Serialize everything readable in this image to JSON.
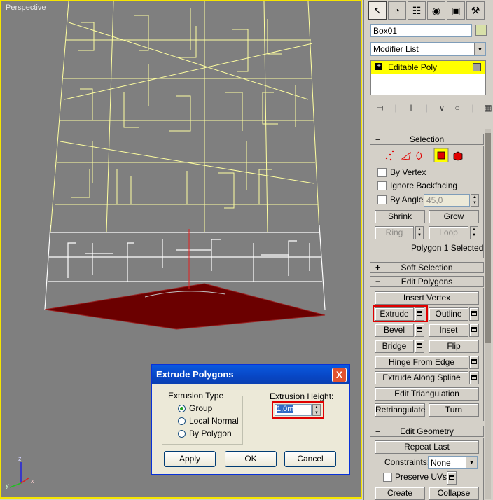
{
  "viewport": {
    "label": "Perspective",
    "axis_labels": {
      "z": "z",
      "y": "y",
      "x": "x"
    },
    "colors": {
      "wire_top": "#ffffa0",
      "wire_bottom": "#ffffff",
      "selected_face": "#6b0000",
      "border": "#f5e400"
    }
  },
  "panel": {
    "tabs": [
      "create-icon",
      "modify-icon",
      "hierarchy-icon",
      "motion-icon",
      "display-icon",
      "utilities-icon"
    ],
    "object_name": "Box01",
    "modifier_list": "Modifier List",
    "stack": {
      "item": "Editable Poly"
    },
    "selection": {
      "header": "Selection",
      "by_vertex": "By Vertex",
      "ignore_backfacing": "Ignore Backfacing",
      "by_angle": "By Angle:",
      "angle_value": "45,0",
      "shrink": "Shrink",
      "grow": "Grow",
      "ring": "Ring",
      "loop": "Loop",
      "status": "Polygon 1 Selected"
    },
    "soft_selection": {
      "header": "Soft Selection"
    },
    "edit_polygons": {
      "header": "Edit Polygons",
      "insert_vertex": "Insert Vertex",
      "extrude": "Extrude",
      "outline": "Outline",
      "bevel": "Bevel",
      "inset": "Inset",
      "bridge": "Bridge",
      "flip": "Flip",
      "hinge_from_edge": "Hinge From Edge",
      "extrude_along_spline": "Extrude Along Spline",
      "edit_triangulation": "Edit Triangulation",
      "retriangulate": "Retriangulate",
      "turn": "Turn"
    },
    "edit_geometry": {
      "header": "Edit Geometry",
      "repeat_last": "Repeat Last",
      "constraints_label": "Constraints:",
      "constraints_value": "None",
      "preserve_uvs": "Preserve UVs",
      "create": "Create",
      "collapse": "Collapse"
    }
  },
  "dialog": {
    "title": "Extrude Polygons",
    "extrusion_type": {
      "label": "Extrusion Type",
      "options": [
        "Group",
        "Local Normal",
        "By Polygon"
      ],
      "selected": "Group"
    },
    "extrusion_height": {
      "label": "Extrusion Height:",
      "value": "1,0m"
    },
    "apply": "Apply",
    "ok": "OK",
    "cancel": "Cancel",
    "close": "X"
  },
  "highlight_color": "#e00000"
}
